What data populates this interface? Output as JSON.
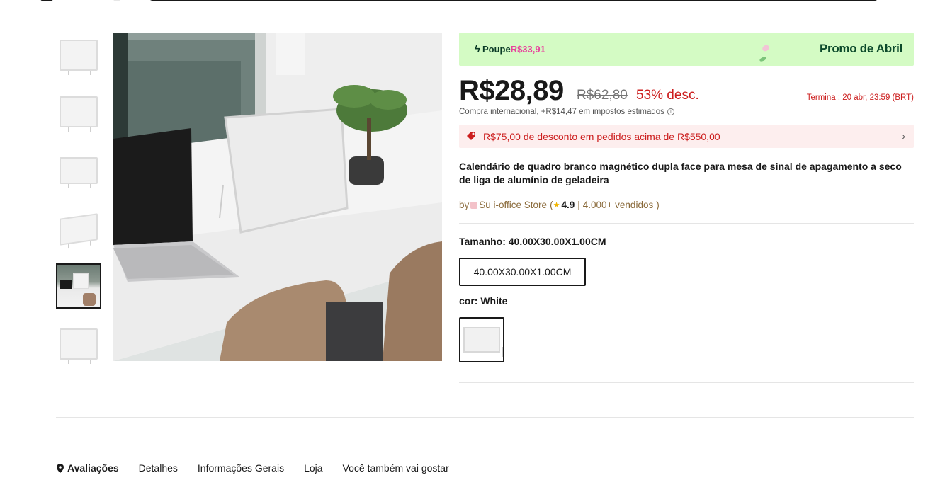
{
  "promo": {
    "poupe_label": "Poupe",
    "save_amount": "R$33,91",
    "title": "Promo de Abril"
  },
  "price": {
    "current": "R$28,89",
    "original": "R$62,80",
    "discount": "53% desc.",
    "ends": "Termina :  20 abr, 23:59 (BRT)"
  },
  "tax_line": "Compra internacional, +R$14,47 em impostos estimados",
  "coupon": "R$75,00 de desconto em pedidos acima de R$550,00",
  "product_title": "Calendário de quadro branco magnético dupla face para mesa de sinal de apagamento a seco de liga de alumínio de geladeira",
  "store": {
    "by": "by",
    "name": "Su i-office Store",
    "open_paren": "(",
    "rating": "4.9",
    "separator": "|",
    "sold": "4.000+ vendidos",
    "close_paren": ")"
  },
  "size": {
    "label": "Tamanho: 40.00X30.00X1.00CM",
    "option": "40.00X30.00X1.00CM"
  },
  "color": {
    "label": "cor: White"
  },
  "tabs": [
    {
      "label": "Avaliações",
      "active": true
    },
    {
      "label": "Detalhes"
    },
    {
      "label": "Informações Gerais"
    },
    {
      "label": "Loja"
    },
    {
      "label": "Você também vai gostar"
    }
  ],
  "colors": {
    "promo_bg": "#d4fbc4",
    "promo_text": "#0c4a2b",
    "save_pink": "#e8429c",
    "discount_red": "#cc1d1d",
    "coupon_bg": "#fdeeee"
  }
}
